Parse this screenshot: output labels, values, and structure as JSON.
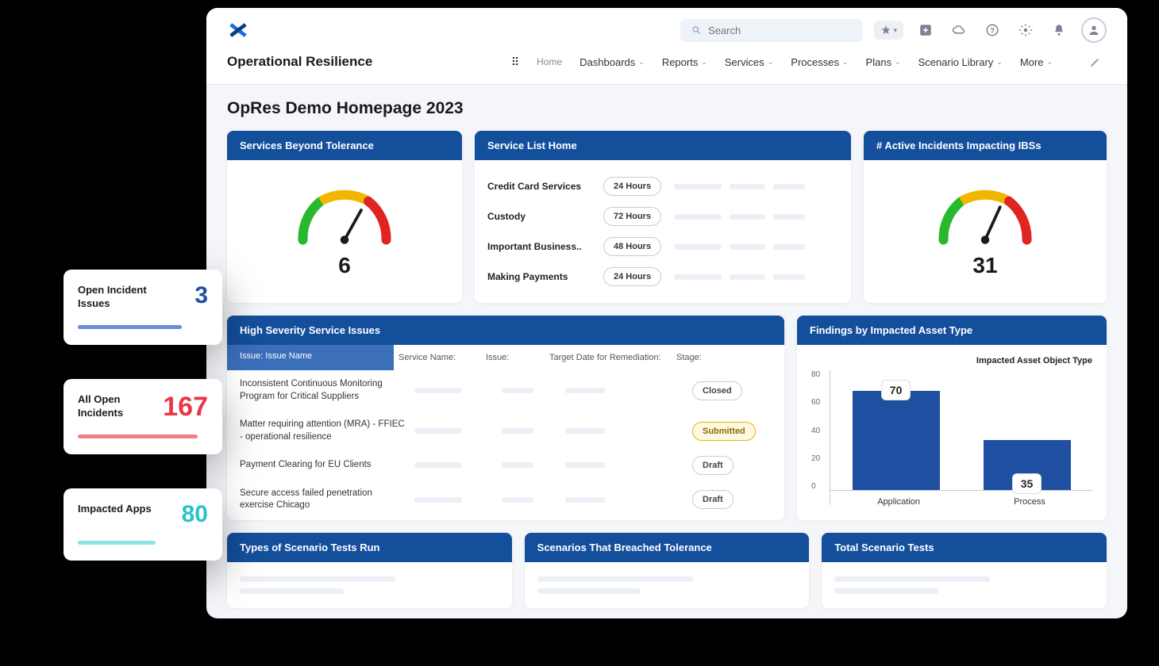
{
  "brand": {
    "title": "Operational Resilience"
  },
  "header": {
    "search_placeholder": "Search",
    "nav": {
      "home": "Home",
      "dashboards": "Dashboards",
      "reports": "Reports",
      "services": "Services",
      "processes": "Processes",
      "plans": "Plans",
      "scenario_library": "Scenario Library",
      "more": "More"
    }
  },
  "page": {
    "title": "OpRes Demo Homepage 2023"
  },
  "cards": {
    "services_beyond": {
      "title": "Services Beyond Tolerance",
      "value": "6"
    },
    "service_list": {
      "title": "Service List Home",
      "rows": [
        {
          "name": "Credit Card Services",
          "badge": "24 Hours"
        },
        {
          "name": "Custody",
          "badge": "72 Hours"
        },
        {
          "name": "Important Business..",
          "badge": "48 Hours"
        },
        {
          "name": "Making Payments",
          "badge": "24 Hours"
        }
      ]
    },
    "active_incidents": {
      "title": "# Active Incidents Impacting IBSs",
      "value": "31"
    },
    "high_severity": {
      "title": "High Severity Service Issues",
      "subtitle": "Issue: Issue Name",
      "columns": {
        "service": "Service Name:",
        "issue": "Issue:",
        "target": "Target Date for Remediation:",
        "stage": "Stage:"
      },
      "rows": [
        {
          "issue": "Inconsistent Continuous Monitoring Program for Critical Suppliers",
          "stage": "Closed",
          "stage_style": "closed"
        },
        {
          "issue": "Matter requiring attention (MRA) - FFIEC - operational resilience",
          "stage": "Submitted",
          "stage_style": "yellow"
        },
        {
          "issue": "Payment Clearing for EU Clients",
          "stage": "Draft",
          "stage_style": "closed"
        },
        {
          "issue": "Secure access failed penetration exercise Chicago",
          "stage": "Draft",
          "stage_style": "closed"
        }
      ]
    },
    "findings": {
      "title": "Findings by Impacted Asset Type",
      "legend": "Impacted Asset Object Type"
    },
    "types_scenario": {
      "title": "Types of Scenario Tests Run"
    },
    "scenarios_breached": {
      "title": "Scenarios That Breached Tolerance"
    },
    "total_scenario": {
      "title": "Total Scenario Tests"
    }
  },
  "chart_data": {
    "type": "bar",
    "title": "Findings by Impacted Asset Type",
    "legend": "Impacted Asset Object Type",
    "xlabel": "",
    "ylabel": "",
    "ylim": [
      0,
      80
    ],
    "yticks": [
      0,
      20,
      40,
      60,
      80
    ],
    "categories": [
      "Application",
      "Process"
    ],
    "values": [
      70,
      35
    ]
  },
  "float_cards": {
    "open_incident_issues": {
      "label": "Open Incident Issues",
      "value": "3"
    },
    "all_open_incidents": {
      "label": "All Open Incidents",
      "value": "167"
    },
    "impacted_apps": {
      "label": "Impacted Apps",
      "value": "80"
    }
  }
}
